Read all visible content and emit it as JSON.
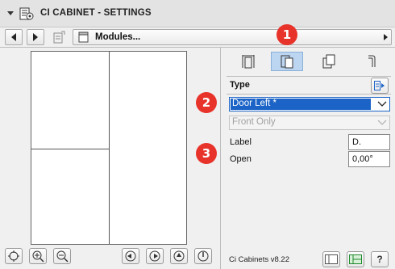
{
  "window": {
    "title": "CI CABINET - SETTINGS"
  },
  "toolbar": {
    "module_label": "Modules..."
  },
  "type_section": {
    "title": "Type",
    "type_value": "Door Left *",
    "subtype_value": "Front Only"
  },
  "fields": {
    "label_caption": "Label",
    "label_value": "D.",
    "open_caption": "Open",
    "open_value": "0,00°"
  },
  "footer": {
    "version": "Ci Cabinets v8.22",
    "help_label": "?"
  },
  "badges": [
    "1",
    "2",
    "3"
  ],
  "colors": {
    "accent": "#1b63c6",
    "badge": "#e8332b",
    "selected_tab": "#bcd6f2"
  }
}
